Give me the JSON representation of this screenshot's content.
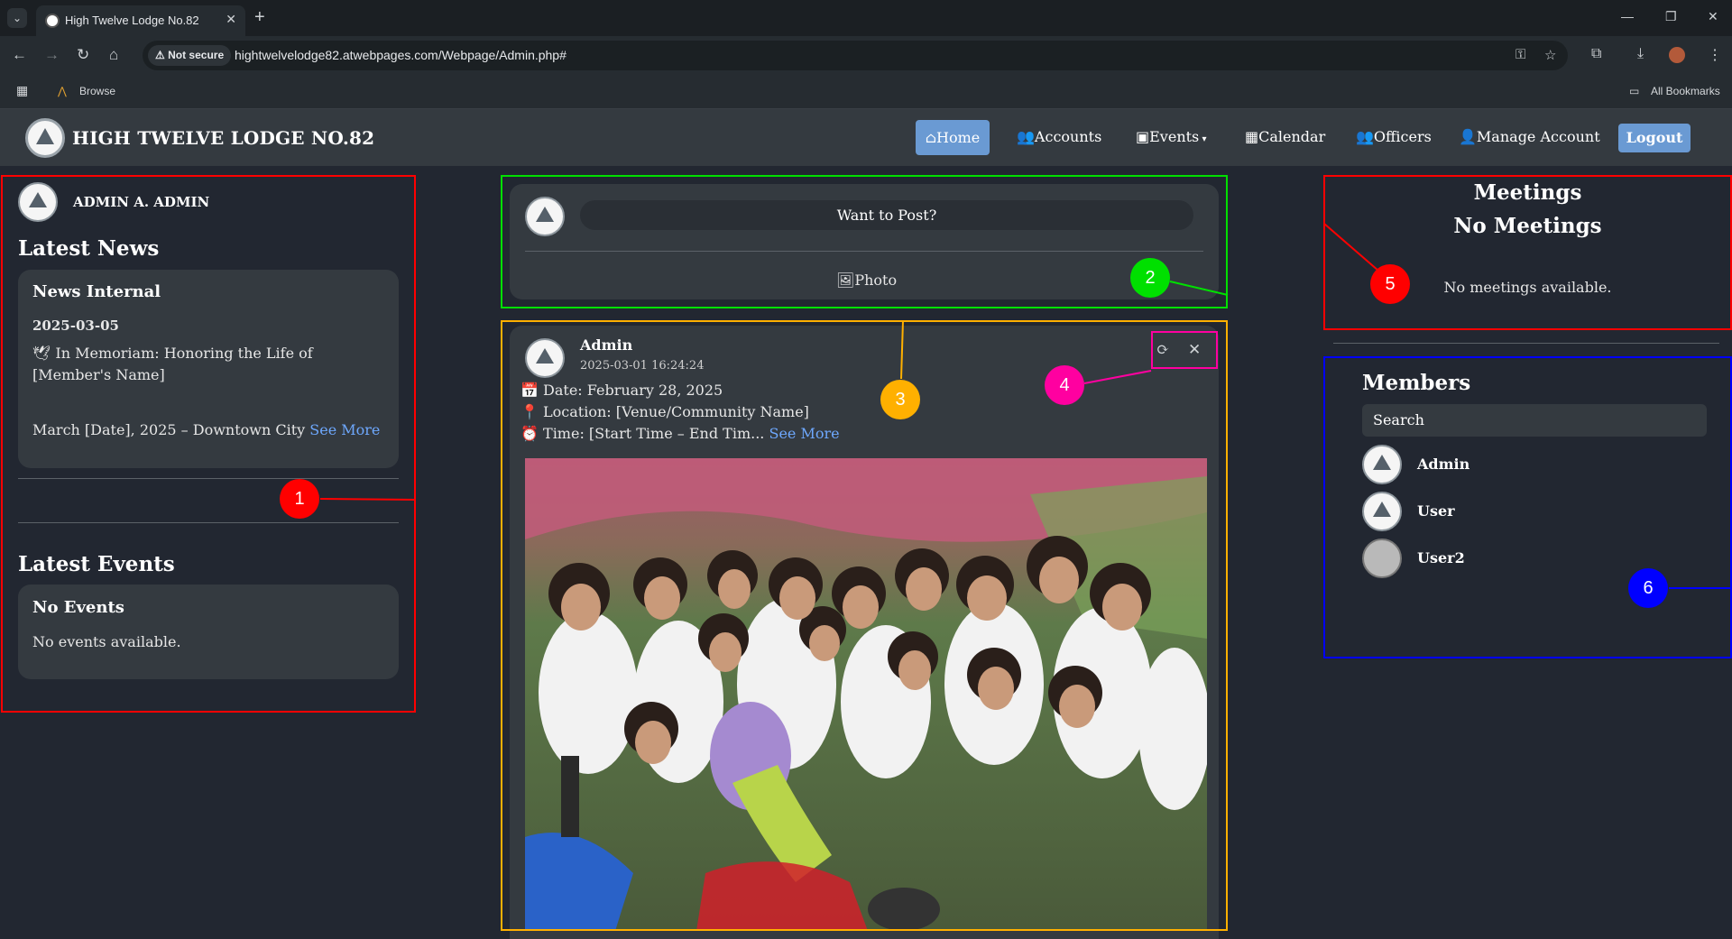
{
  "browser": {
    "tab_title": "High Twelve Lodge No.82",
    "not_secure": "Not secure",
    "url": "hightwelvelodge82.atwebpages.com/Webpage/Admin.php#",
    "bookmark_browse": "Browse",
    "all_bookmarks": "All Bookmarks"
  },
  "navbar": {
    "brand": "HIGH TWELVE LODGE NO.82",
    "items": {
      "home": "Home",
      "accounts": "Accounts",
      "events": "Events",
      "calendar": "Calendar",
      "officers": "Officers",
      "manage_account": "Manage Account",
      "logout": "Logout"
    }
  },
  "left": {
    "user_name": "ADMIN A. ADMIN",
    "latest_news_title": "Latest News",
    "news": {
      "title": "News Internal",
      "date": "2025-03-05",
      "line1": "🕊 In Memoriam: Honoring the Life of [Member's Name]",
      "line2": "March [Date], 2025 – Downtown City",
      "see_more": "See More"
    },
    "latest_events_title": "Latest Events",
    "events": {
      "title": "No Events",
      "text": "No events available."
    }
  },
  "composer": {
    "placeholder": "Want to Post?",
    "photo_label": "Photo"
  },
  "post": {
    "author": "Admin",
    "timestamp": "2025-03-01 16:24:24",
    "line_date": "Date: February 28, 2025",
    "line_location": "Location: [Venue/Community Name]",
    "line_time": "Time: [Start Time – End Tim...",
    "see_more": "See More"
  },
  "right": {
    "meetings_title": "Meetings",
    "meetings_subtitle": "No Meetings",
    "meetings_text": "No meetings available.",
    "members_title": "Members",
    "search_placeholder": "Search",
    "members": [
      "Admin",
      "User",
      "User2"
    ]
  },
  "annotations": {
    "labels": [
      "1",
      "2",
      "3",
      "4",
      "5",
      "6"
    ],
    "colors": {
      "1": "#ff0000",
      "2": "#00e000",
      "3": "#ffb000",
      "4": "#ff00a0",
      "5": "#ff0000",
      "6": "#0000ff"
    }
  }
}
